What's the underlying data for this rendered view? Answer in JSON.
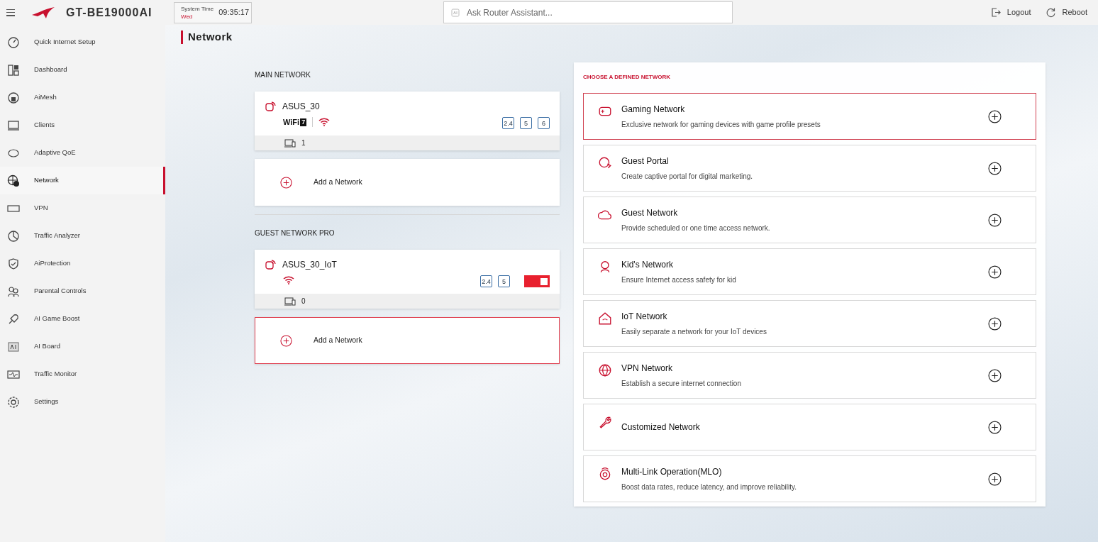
{
  "header": {
    "model": "GT-BE19000AI",
    "system_time_label": "System Time",
    "day": "Wed",
    "time": "09:35:17",
    "search": {
      "placeholder": "Ask Router Assistant..."
    },
    "actions": [
      "Logout",
      "Reboot"
    ]
  },
  "sidebar": {
    "items": [
      {
        "label": "Quick Internet Setup",
        "selected": false
      },
      {
        "label": "Dashboard",
        "selected": false
      },
      {
        "label": "AiMesh",
        "selected": false
      },
      {
        "label": "Clients",
        "selected": false
      },
      {
        "label": "Adaptive QoE",
        "selected": false
      },
      {
        "label": "Network",
        "selected": true
      },
      {
        "label": "VPN",
        "selected": false
      },
      {
        "label": "Traffic Analyzer",
        "selected": false
      },
      {
        "label": "AiProtection",
        "selected": false
      },
      {
        "label": "Parental Controls",
        "selected": false
      },
      {
        "label": "AI Game Boost",
        "selected": false
      },
      {
        "label": "AI Board",
        "selected": false
      },
      {
        "label": "Traffic Monitor",
        "selected": false
      },
      {
        "label": "Settings",
        "selected": false
      }
    ]
  },
  "page_title": "Network",
  "sections": [
    {
      "heading": "MAIN NETWORK",
      "networks": [
        {
          "name": "ASUS_30",
          "wifi_badge": [
            "WiFi",
            "7"
          ],
          "bands": [
            "2.4",
            "5",
            "6"
          ],
          "clients": "1"
        }
      ],
      "add": {
        "label": "Add a Network",
        "highlighted": false
      }
    },
    {
      "heading": "GUEST NETWORK PRO",
      "networks": [
        {
          "name": "ASUS_30_IoT",
          "bands": [
            "2.4",
            "5"
          ],
          "on": true,
          "clients": "0"
        }
      ],
      "add": {
        "label": "Add a Network",
        "highlighted": true
      }
    }
  ],
  "defined": {
    "heading": "CHOOSE A DEFINED NETWORK",
    "items": [
      {
        "title": "Gaming Network",
        "desc": "Exclusive network for gaming devices with game profile presets",
        "highlighted": true
      },
      {
        "title": "Guest Portal",
        "desc": "Create captive portal for digital marketing.",
        "highlighted": false
      },
      {
        "title": "Guest Network",
        "desc": "Provide scheduled or one time access network.",
        "highlighted": false
      },
      {
        "title": "Kid's Network",
        "desc": "Ensure Internet access safety for kid",
        "highlighted": false
      },
      {
        "title": "IoT Network",
        "desc": "Easily separate a network for your IoT devices",
        "highlighted": false
      },
      {
        "title": "VPN Network",
        "desc": "Establish a secure internet connection",
        "highlighted": false
      },
      {
        "title": "Customized Network",
        "highlighted": false
      },
      {
        "title": "Multi-Link Operation(MLO)",
        "desc": "Boost data rates, reduce latency, and improve reliability.",
        "highlighted": false
      }
    ]
  }
}
